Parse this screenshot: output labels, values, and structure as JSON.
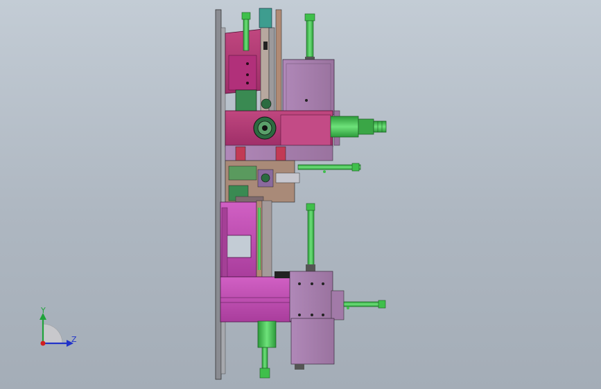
{
  "triad": {
    "y_label": "Y",
    "z_label": "Z",
    "y_color": "#1fa33a",
    "z_color": "#2133c9",
    "x_color": "#d11f1f"
  },
  "colors": {
    "background_top": "#c3ccd5",
    "background_bottom": "#a4adb7",
    "magenta_part": "#c64fb6",
    "pink_part": "#b8397c",
    "mauve_housing": "#a27aa8",
    "green_rod": "#3fbf4b",
    "teal_block": "#3e9d8f",
    "tan_plate": "#b08a74",
    "grey_plate": "#8e8e92"
  }
}
